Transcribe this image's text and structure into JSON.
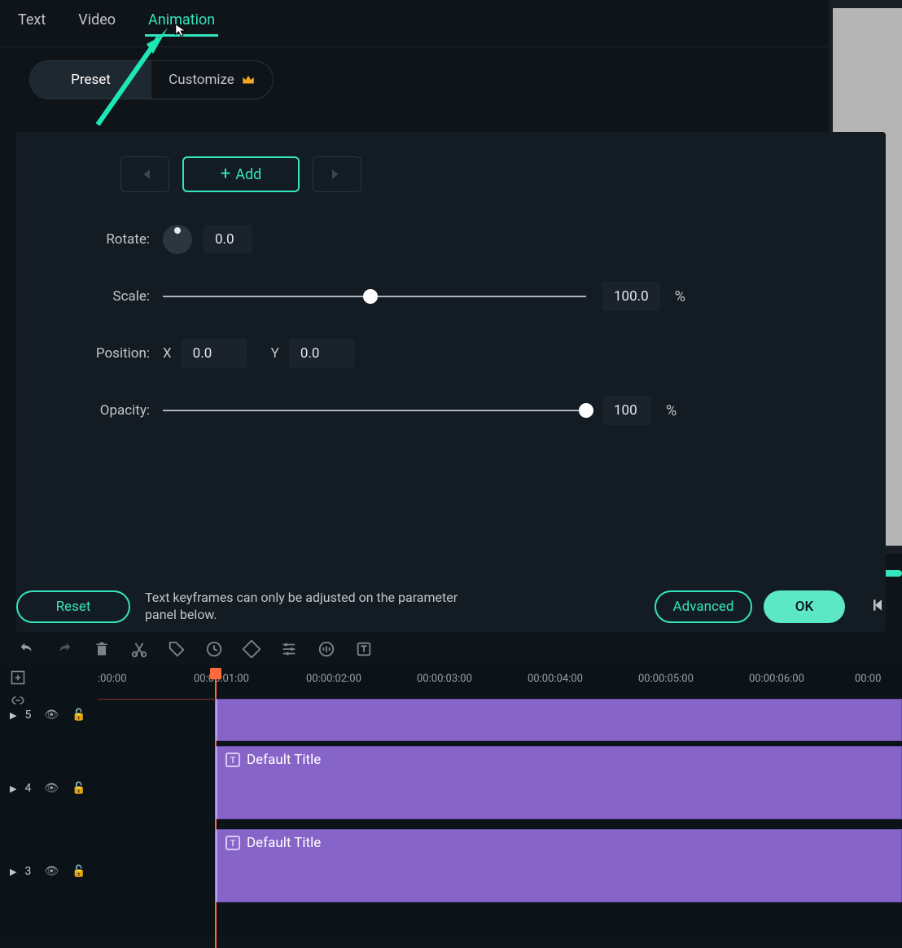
{
  "tabs": {
    "text": "Text",
    "video": "Video",
    "animation": "Animation"
  },
  "subtabs": {
    "preset": "Preset",
    "customize": "Customize"
  },
  "buttons": {
    "add": "Add",
    "reset": "Reset",
    "advanced": "Advanced",
    "ok": "OK"
  },
  "props": {
    "rotate_label": "Rotate:",
    "rotate_val": "0.0",
    "scale_label": "Scale:",
    "scale_val": "100.0",
    "scale_unit": "%",
    "position_label": "Position:",
    "x_label": "X",
    "x_val": "0.0",
    "y_label": "Y",
    "y_val": "0.0",
    "opacity_label": "Opacity:",
    "opacity_val": "100",
    "opacity_unit": "%"
  },
  "hint": "Text keyframes can only be adjusted on the parameter panel below.",
  "timeline": {
    "marks": [
      ":00:00",
      "00:00:01:00",
      "00:00:02:00",
      "00:00:03:00",
      "00:00:04:00",
      "00:00:05:00",
      "00:00:06:00",
      "00:00"
    ],
    "tracks": {
      "t5": "5",
      "t4": "4",
      "t3": "3"
    },
    "clip_label": "Default Title"
  }
}
